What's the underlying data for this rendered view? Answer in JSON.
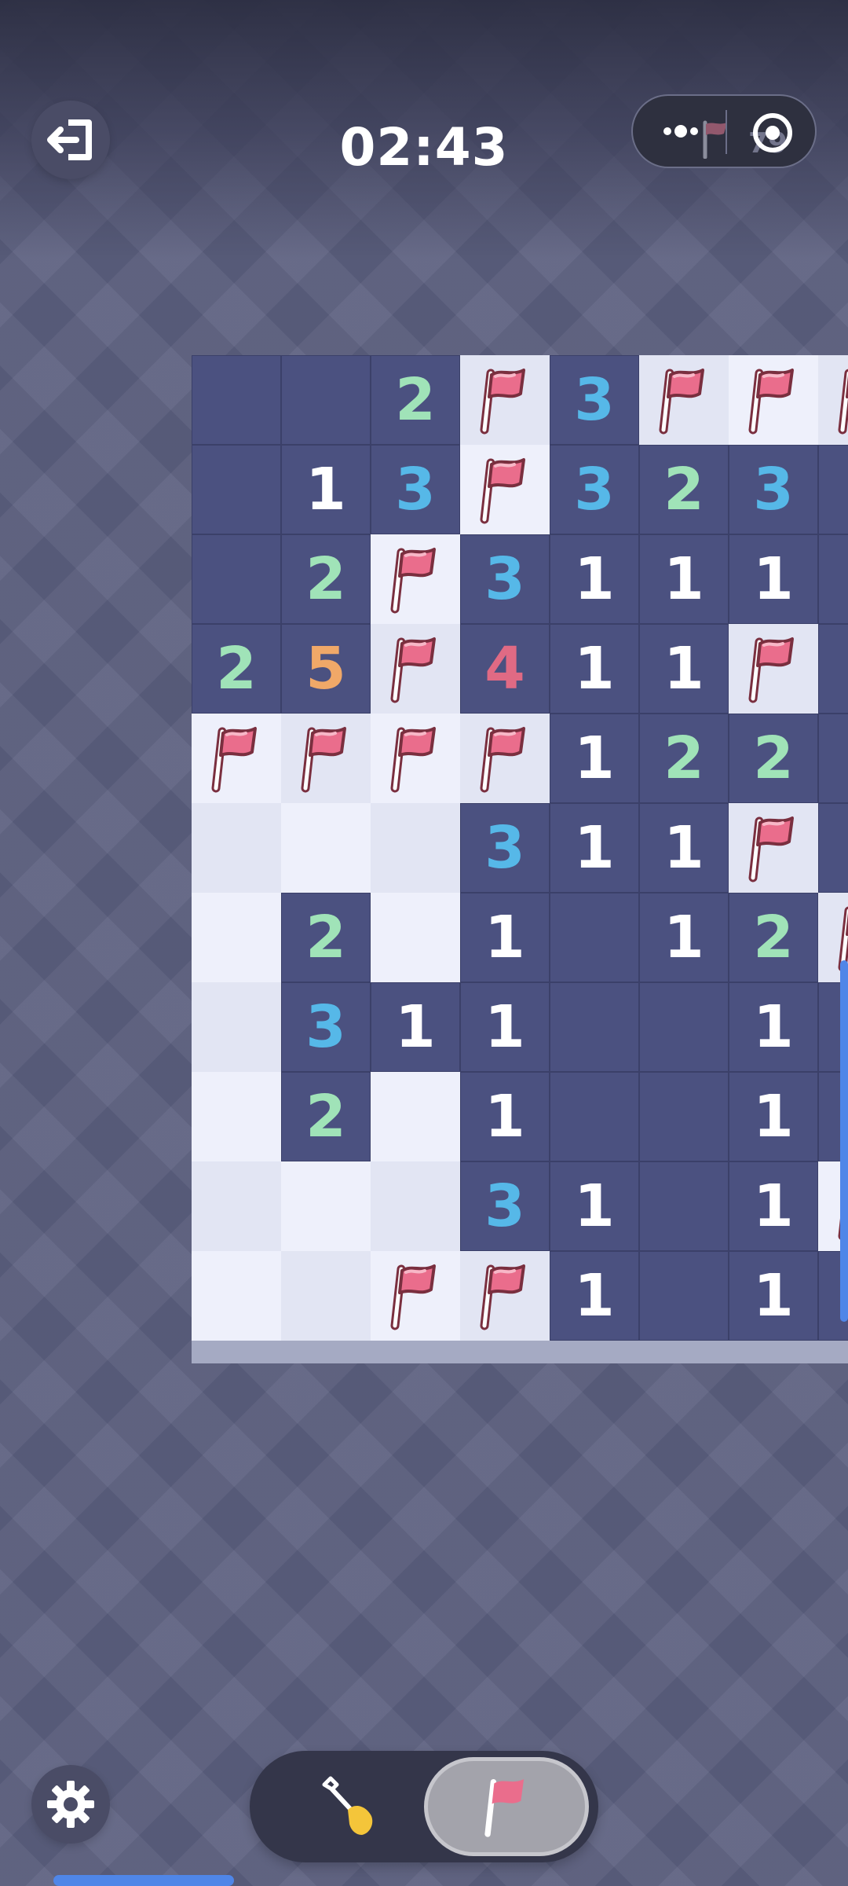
{
  "header": {
    "timer": "02:43",
    "mine_count": "79",
    "icons": [
      "exit-icon",
      "more-icon",
      "flag-icon",
      "record-icon"
    ]
  },
  "colors": {
    "1": "#ffffff",
    "2": "#a0e3b8",
    "3": "#56b8e8",
    "4": "#e06a84",
    "5": "#f0a868",
    "covered": "#4b5180",
    "open_light": "#eef0fb",
    "open_alt": "#e2e5f3",
    "flag": "#ea6d8c"
  },
  "board": {
    "legend": "c = revealed (dark), u = open (light), F = flag, digits = count",
    "rows": [
      [
        "c",
        "c",
        "2",
        "F",
        "3",
        "F",
        "F",
        "F"
      ],
      [
        "c",
        "1",
        "3",
        "F",
        "3",
        "2",
        "3",
        "c"
      ],
      [
        "c",
        "2",
        "F",
        "3",
        "1",
        "1",
        "1",
        "c"
      ],
      [
        "2",
        "5",
        "F",
        "4",
        "1",
        "1",
        "F",
        "c"
      ],
      [
        "F",
        "F",
        "F",
        "F",
        "1",
        "2",
        "2",
        "c"
      ],
      [
        "u",
        "u",
        "u",
        "3",
        "1",
        "1",
        "F",
        "c"
      ],
      [
        "u",
        "2",
        "u",
        "1",
        "c",
        "1",
        "2",
        "F"
      ],
      [
        "u",
        "3",
        "1",
        "1",
        "c",
        "c",
        "1",
        "c"
      ],
      [
        "u",
        "2",
        "u",
        "1",
        "c",
        "c",
        "1",
        "c"
      ],
      [
        "u",
        "u",
        "u",
        "3",
        "1",
        "c",
        "1",
        "F"
      ],
      [
        "u",
        "u",
        "F",
        "F",
        "1",
        "c",
        "1",
        "c"
      ]
    ]
  },
  "controls": {
    "mode": "flag",
    "icons": [
      "shovel-icon",
      "flag-icon",
      "gear-icon"
    ]
  }
}
